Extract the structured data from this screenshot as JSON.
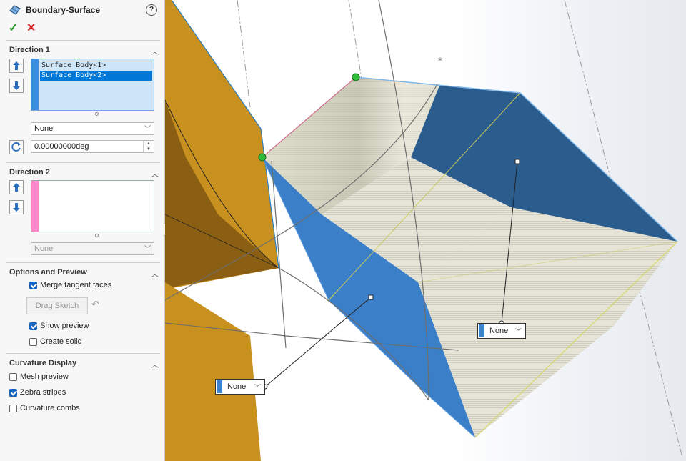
{
  "feature": {
    "title": "Boundary-Surface",
    "help": "?"
  },
  "actions": {
    "ok": "✓",
    "cancel": "✕"
  },
  "direction1": {
    "header": "Direction 1",
    "items": [
      "Surface Body<1>",
      "Surface Body<2>"
    ],
    "selected_index": 1,
    "stripe_color": "#3b8de0",
    "tangency": "None",
    "angle": "0.00000000deg"
  },
  "direction2": {
    "header": "Direction 2",
    "items": [],
    "stripe_color": "#ff86c8",
    "tangency": "None"
  },
  "options": {
    "header": "Options and Preview",
    "merge_tangent_faces": {
      "label": "Merge tangent faces",
      "checked": true
    },
    "drag_sketch": "Drag Sketch",
    "show_preview": {
      "label": "Show preview",
      "checked": true
    },
    "create_solid": {
      "label": "Create solid",
      "checked": false
    }
  },
  "curvature": {
    "header": "Curvature Display",
    "mesh_preview": {
      "label": "Mesh preview",
      "checked": false
    },
    "zebra_stripes": {
      "label": "Zebra stripes",
      "checked": true
    },
    "curvature_combs": {
      "label": "Curvature combs",
      "checked": false
    }
  },
  "viewport": {
    "callout_left": "None",
    "callout_right": "None",
    "colors": {
      "gold": "#c8901e",
      "blue_dark": "#2b5c8e",
      "blue_light": "#3c7fc9",
      "zebra": "#e4e2d3"
    }
  }
}
